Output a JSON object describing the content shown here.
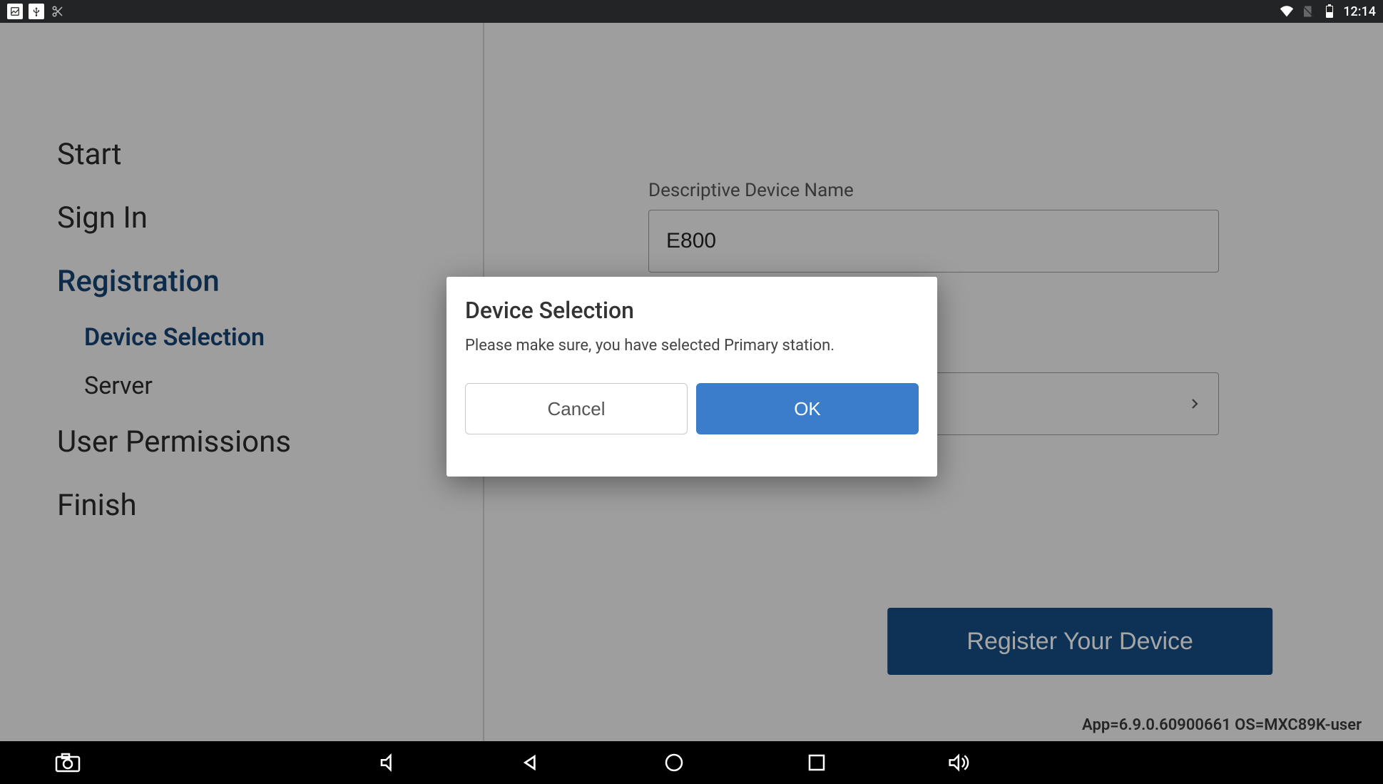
{
  "status_bar": {
    "time": "12:14"
  },
  "sidebar": {
    "items": [
      {
        "label": "Start",
        "active": false
      },
      {
        "label": "Sign In",
        "active": false
      },
      {
        "label": "Registration",
        "active": true
      },
      {
        "label": "User Permissions",
        "active": false
      },
      {
        "label": "Finish",
        "active": false
      }
    ],
    "registration_sub": [
      {
        "label": "Device Selection",
        "active": true
      },
      {
        "label": "Server",
        "active": false
      }
    ]
  },
  "form": {
    "device_name_label": "Descriptive Device Name",
    "device_name_value": "E800",
    "register_button": "Register Your Device"
  },
  "footer": {
    "version": "App=6.9.0.60900661 OS=MXC89K-user"
  },
  "dialog": {
    "title": "Device Selection",
    "message": "Please make sure, you have selected Primary station.",
    "cancel": "Cancel",
    "ok": "OK"
  }
}
